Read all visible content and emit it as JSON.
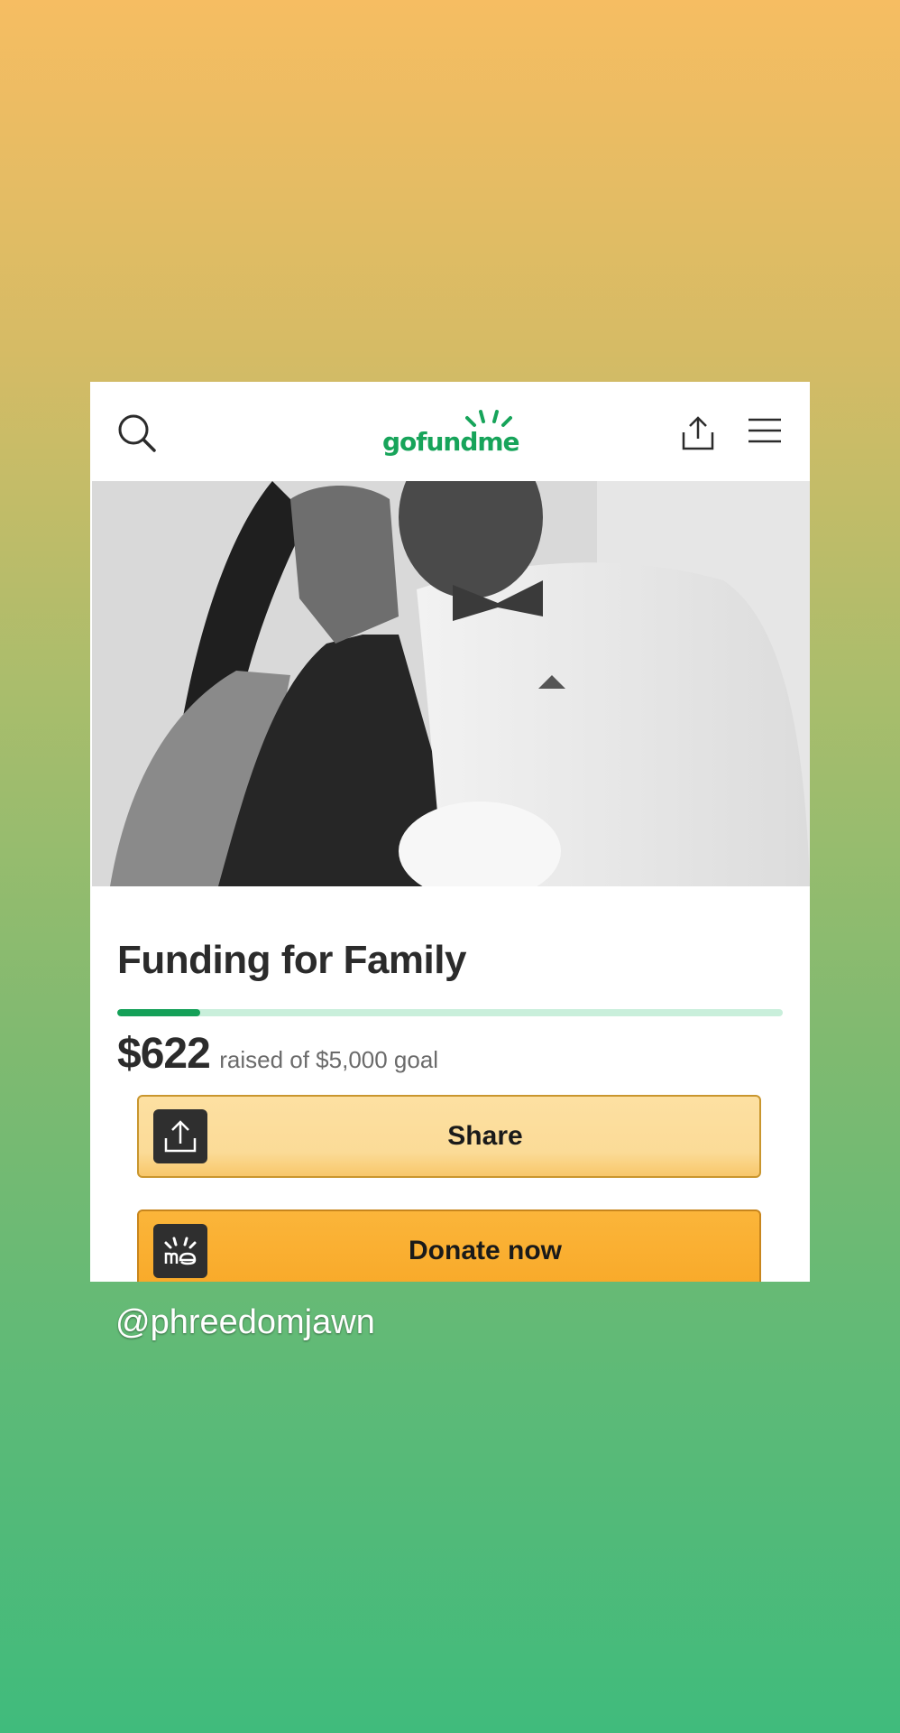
{
  "header": {
    "logo_text": "gofundme",
    "icons": [
      "search-icon",
      "share-icon",
      "menu-icon"
    ]
  },
  "hero": {
    "description_icon": "couple-photo"
  },
  "campaign": {
    "title": "Funding for Family",
    "raised": "$622",
    "goal_text": "raised of $5,000 goal",
    "progress_fraction": 0.124
  },
  "buttons": {
    "share_label": "Share",
    "donate_label": "Donate now"
  },
  "footer": {
    "handle": "@phreedomjawn"
  },
  "colors": {
    "brand_green": "#17a45a",
    "share_button": "#fbdb97",
    "donate_button": "#f9ae30"
  }
}
